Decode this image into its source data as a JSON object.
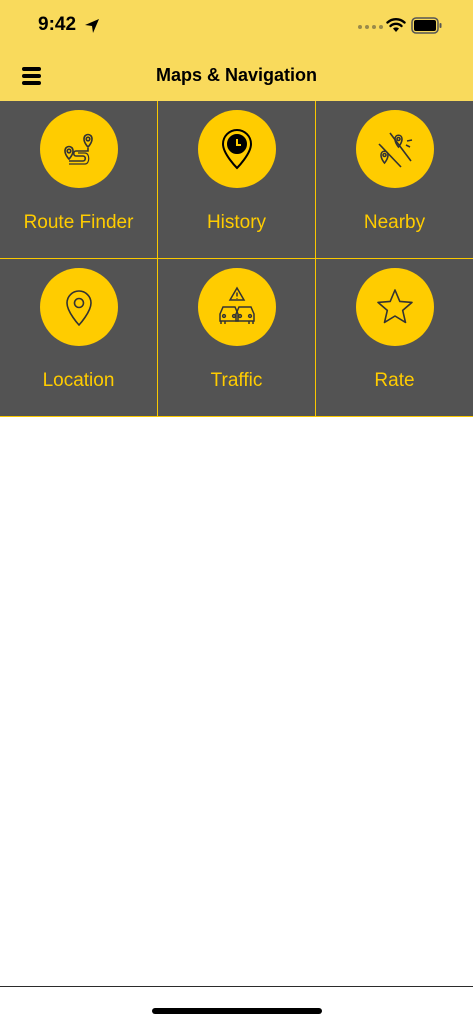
{
  "status_bar": {
    "time": "9:42",
    "icons": [
      "location-arrow-icon",
      "signal-dots-icon",
      "wifi-icon",
      "battery-icon"
    ]
  },
  "header": {
    "title": "Maps & Navigation",
    "menu_icon": "hamburger-menu-icon"
  },
  "colors": {
    "header_background": "#F9DA5C",
    "tile_background": "#535353",
    "accent": "#FFCC00"
  },
  "tiles": [
    {
      "label": "Route Finder",
      "icon": "route-icon"
    },
    {
      "label": "History",
      "icon": "history-pin-icon"
    },
    {
      "label": "Nearby",
      "icon": "nearby-icon"
    },
    {
      "label": "Location",
      "icon": "location-pin-icon"
    },
    {
      "label": "Traffic",
      "icon": "traffic-icon"
    },
    {
      "label": "Rate",
      "icon": "star-icon"
    }
  ]
}
